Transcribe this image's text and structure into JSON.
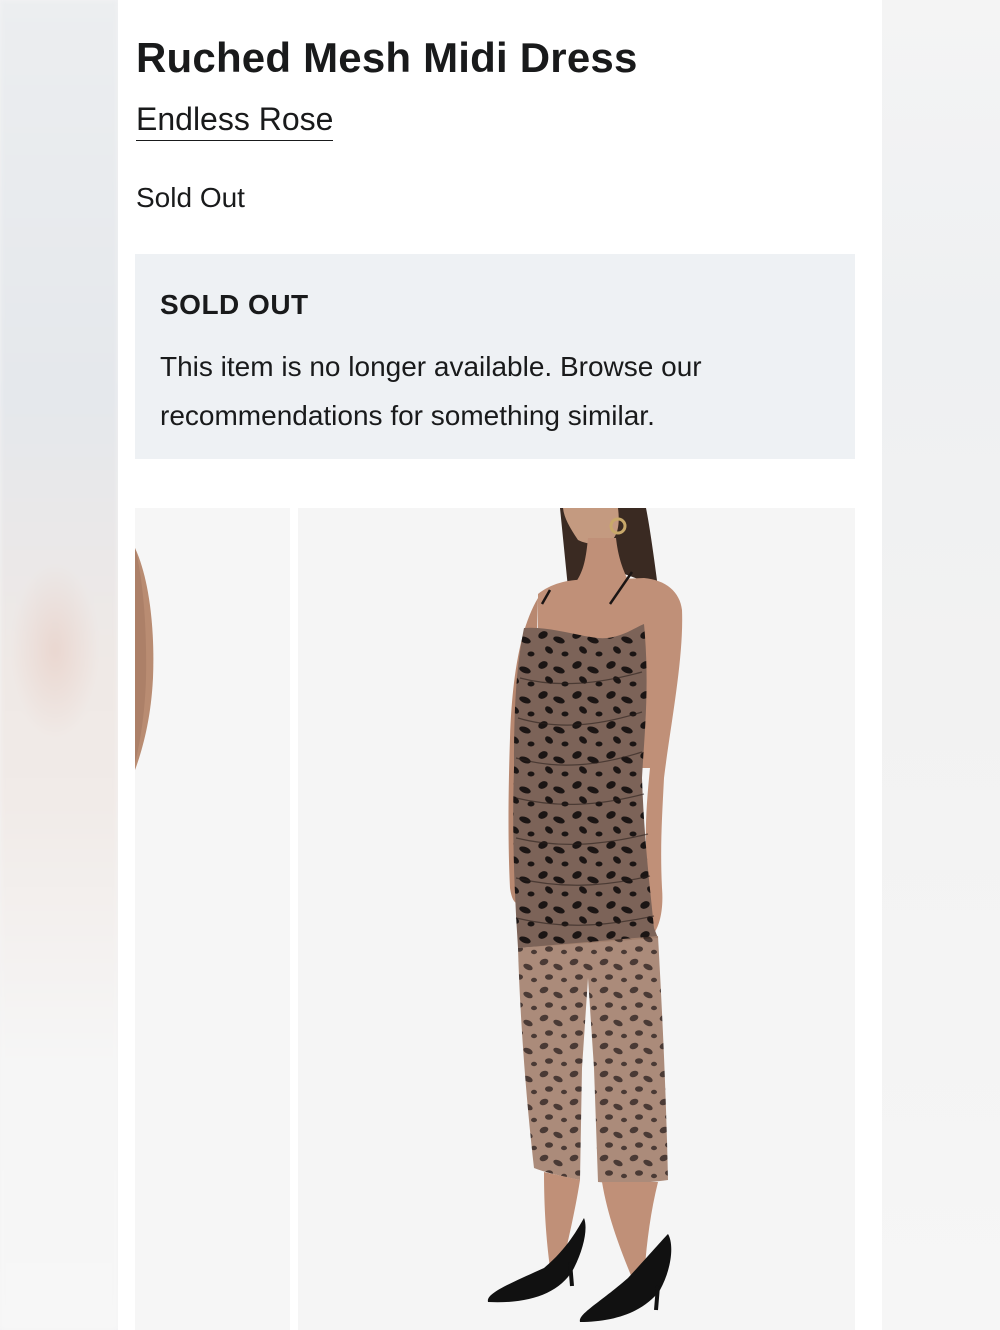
{
  "product": {
    "title": "Ruched Mesh Midi Dress",
    "brand": "Endless Rose",
    "status": "Sold Out"
  },
  "notice": {
    "title": "SOLD OUT",
    "message": "This item is no longer available. Browse our recommendations for something similar."
  },
  "gallery": {
    "images": [
      {
        "name": "product-image-partial",
        "icon": "dress-photo"
      },
      {
        "name": "product-image-main",
        "icon": "dress-photo"
      }
    ]
  },
  "colors": {
    "text": "#191a1b",
    "notice_bg": "#eef1f4",
    "image_bg": "#f5f5f5"
  }
}
